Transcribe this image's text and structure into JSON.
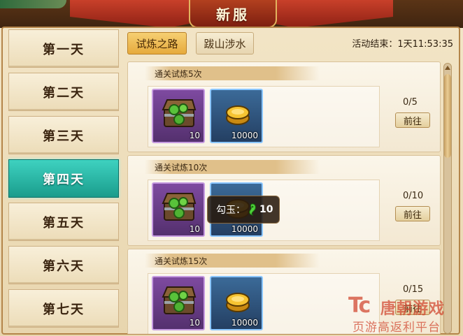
{
  "window": {
    "title": "新服"
  },
  "sidebar": {
    "items": [
      {
        "label": "第一天",
        "active": false
      },
      {
        "label": "第二天",
        "active": false
      },
      {
        "label": "第三天",
        "active": false
      },
      {
        "label": "第四天",
        "active": true
      },
      {
        "label": "第五天",
        "active": false
      },
      {
        "label": "第六天",
        "active": false
      },
      {
        "label": "第七天",
        "active": false
      }
    ]
  },
  "tabs": [
    {
      "label": "试炼之路",
      "active": true
    },
    {
      "label": "跋山涉水",
      "active": false
    }
  ],
  "countdown": {
    "text": "活动结束：1天11:53:35"
  },
  "tasks": [
    {
      "title": "通关试炼5次",
      "rewards": [
        {
          "icon": "jade-chest-icon",
          "qty": "10"
        },
        {
          "icon": "gold-coin-icon",
          "qty": "10000"
        }
      ],
      "progress": "0/5",
      "button": "前往"
    },
    {
      "title": "通关试炼10次",
      "rewards": [
        {
          "icon": "jade-chest-icon",
          "qty": "10"
        },
        {
          "icon": "gold-coin-icon",
          "qty": "10000"
        }
      ],
      "progress": "0/10",
      "button": "前往"
    },
    {
      "title": "通关试炼15次",
      "rewards": [
        {
          "icon": "jade-chest-icon",
          "qty": "10"
        },
        {
          "icon": "gold-coin-icon",
          "qty": "10000"
        }
      ],
      "progress": "0/15",
      "button": "前往"
    }
  ],
  "tooltip": {
    "label": "勾玉：",
    "icon": "jade-magatama-icon",
    "value": "10"
  },
  "watermark": {
    "logo": "Tc",
    "name": "唐朝游戏",
    "sub": "页游高返利平台"
  },
  "colors": {
    "accent_active": "#1a9c8c",
    "tab_active": "#e6aa3d",
    "banner": "#8e2114",
    "watermark": "#d24a33"
  }
}
